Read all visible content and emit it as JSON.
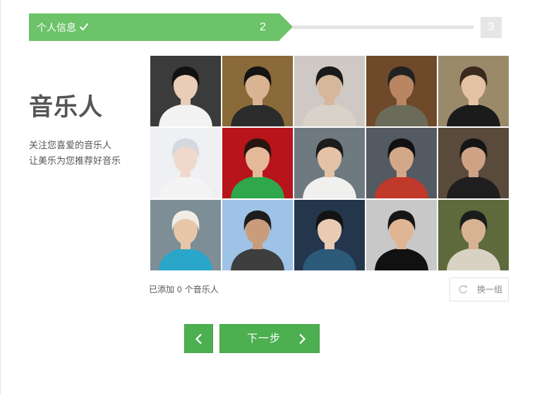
{
  "progress": {
    "step1_label": "个人信息",
    "step2_number": "2",
    "step3_number": "3"
  },
  "intro": {
    "title": "音乐人",
    "desc_line1": "关注您喜爱的音乐人",
    "desc_line2": "让美乐为您推荐好音乐"
  },
  "musicians": [
    {
      "bg": "#3b3b3b",
      "skin": "#e9cdb8",
      "hair": "#111111",
      "cloth": "#f2f2f2"
    },
    {
      "bg": "#8a6a38",
      "skin": "#d9b392",
      "hair": "#141414",
      "cloth": "#2b2b2b"
    },
    {
      "bg": "#cfc9c5",
      "skin": "#d7b79b",
      "hair": "#1a1a1a",
      "cloth": "#d9d2c9"
    },
    {
      "bg": "#6e4a2a",
      "skin": "#b98562",
      "hair": "#222222",
      "cloth": "#6b6b5a"
    },
    {
      "bg": "#9a8a6a",
      "skin": "#e4c2a3",
      "hair": "#3a2a1e",
      "cloth": "#1b1b1b"
    },
    {
      "bg": "#eef0f4",
      "skin": "#f0d9cc",
      "hair": "#d6d8df",
      "cloth": "#f4f4f4"
    },
    {
      "bg": "#b8141b",
      "skin": "#e6b89a",
      "hair": "#2a1610",
      "cloth": "#2ea84a"
    },
    {
      "bg": "#6f7a80",
      "skin": "#e3c2a8",
      "hair": "#1c1c1c",
      "cloth": "#f0f0ee"
    },
    {
      "bg": "#545a62",
      "skin": "#d3a888",
      "hair": "#111111",
      "cloth": "#c0392b"
    },
    {
      "bg": "#5a4a3c",
      "skin": "#cfa286",
      "hair": "#151515",
      "cloth": "#1e1e1e"
    },
    {
      "bg": "#7d8e96",
      "skin": "#e8c6a8",
      "hair": "#f1ede6",
      "cloth": "#2aa6c8"
    },
    {
      "bg": "#9fc3e6",
      "skin": "#c99c7c",
      "hair": "#1d1d1d",
      "cloth": "#3e3e3e"
    },
    {
      "bg": "#23364c",
      "skin": "#e9cbb3",
      "hair": "#131313",
      "cloth": "#2c5b7a"
    },
    {
      "bg": "#c8c8c8",
      "skin": "#dfb594",
      "hair": "#151515",
      "cloth": "#111111"
    },
    {
      "bg": "#5e6a3c",
      "skin": "#d8b393",
      "hair": "#1c1c1c",
      "cloth": "#d8d2c4"
    }
  ],
  "footer": {
    "added_prefix": "已添加",
    "added_count": "0",
    "added_suffix": "个音乐人",
    "refresh_label": "换一组"
  },
  "nav": {
    "next_label": "下一步"
  },
  "colors": {
    "accent": "#6cc36a",
    "button": "#4caf50"
  }
}
